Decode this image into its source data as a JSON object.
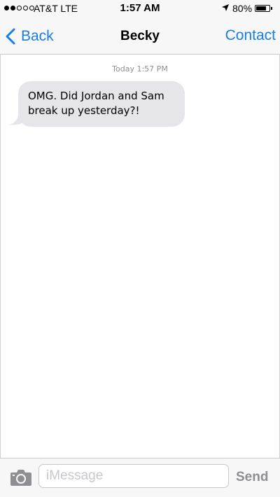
{
  "status_bar": {
    "signal_strength": "2 of 5",
    "carrier": "AT&T LTE",
    "time": "1:57 AM",
    "location_icon": "location-arrow-icon",
    "battery_percent": "80%",
    "battery_level": 0.8
  },
  "nav": {
    "back_label": "Back",
    "back_icon": "chevron-left-icon",
    "title": "Becky",
    "contact_label": "Contact"
  },
  "conversation": {
    "timestamp": "Today 1:57 PM",
    "messages": [
      {
        "direction": "incoming",
        "text": "OMG. Did Jordan and Sam break up yesterday?!"
      }
    ]
  },
  "input_bar": {
    "camera_icon": "camera-icon",
    "placeholder": "iMessage",
    "value": "",
    "send_label": "Send"
  },
  "colors": {
    "accent": "#1a7ee0",
    "incoming_bubble": "#e5e5ea",
    "send_disabled": "#8e8e93"
  }
}
